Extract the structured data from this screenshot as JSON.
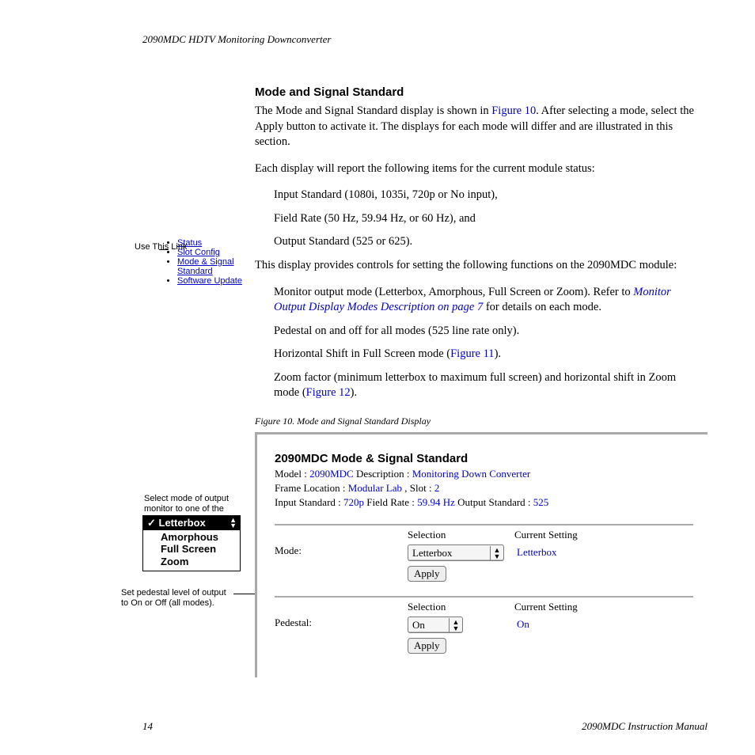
{
  "header": "2090MDC HDTV Monitoring Downconverter",
  "section_heading": "Mode and Signal Standard",
  "p1a": "The Mode and Signal Standard display is shown in ",
  "p1_link": "Figure 10",
  "p1b": ". After selecting a mode, select the Apply button to activate it. The displays for each mode will differ and are illustrated in this section.",
  "p2": "Each display will report the following items for the current module status:",
  "li1": "Input Standard (1080i, 1035i, 720p or No input),",
  "li2": "Field Rate (50 Hz, 59.94 Hz, or 60 Hz), and",
  "li3": "Output Standard (525 or 625).",
  "p3": "This display provides controls for setting the following functions on the 2090MDC module:",
  "li4a": "Monitor output mode (Letterbox, Amorphous, Full Screen or Zoom). Refer to ",
  "li4_link": "Monitor Output Display Modes Description on page 7",
  "li4b": " for details on each mode.",
  "li5": "Pedestal on and off for all modes (525 line rate only).",
  "li6a": "Horizontal Shift in Full Screen mode (",
  "li6_link": "Figure 11",
  "li6b": ").",
  "li7a": "Zoom factor (minimum letterbox to maximum full screen) and horizontal shift in Zoom mode (",
  "li7_link": "Figure 12",
  "li7b": ").",
  "sidebar": {
    "label": "Use This Link",
    "items": [
      "Status",
      "Slot Config",
      "Mode & Signal Standard",
      "Software Update"
    ]
  },
  "figure_caption": "Figure 10.  Mode and Signal Standard Display",
  "annot1": "Select mode of output monitor to one of the following:",
  "annot2": "Set pedestal level of output to On or Off (all modes).",
  "select_box": {
    "selected": "Letterbox",
    "options": [
      "Amorphous",
      "Full Screen",
      "Zoom"
    ]
  },
  "fig": {
    "title": "2090MDC Mode & Signal Standard",
    "model_lbl": "Model : ",
    "model": "2090MDC",
    "desc_lbl": " Description : ",
    "desc": "Monitoring Down Converter",
    "frame_lbl": "Frame Location : ",
    "frame": "Modular Lab",
    "slot_lbl": " , Slot : ",
    "slot": "2",
    "instd_lbl": "Input Standard : ",
    "instd": "720p",
    "fr_lbl": "  Field Rate : ",
    "fr": "59.94 Hz",
    "out_lbl": "  Output Standard : ",
    "out": "525",
    "selection_hdr": "Selection",
    "current_hdr": "Current Setting",
    "mode_lbl": "Mode:",
    "mode_sel": "Letterbox",
    "mode_cur": "Letterbox",
    "ped_lbl": "Pedestal:",
    "ped_sel": "On",
    "ped_cur": "On",
    "apply": "Apply"
  },
  "footer": {
    "page": "14",
    "title": "2090MDC Instruction Manual"
  }
}
